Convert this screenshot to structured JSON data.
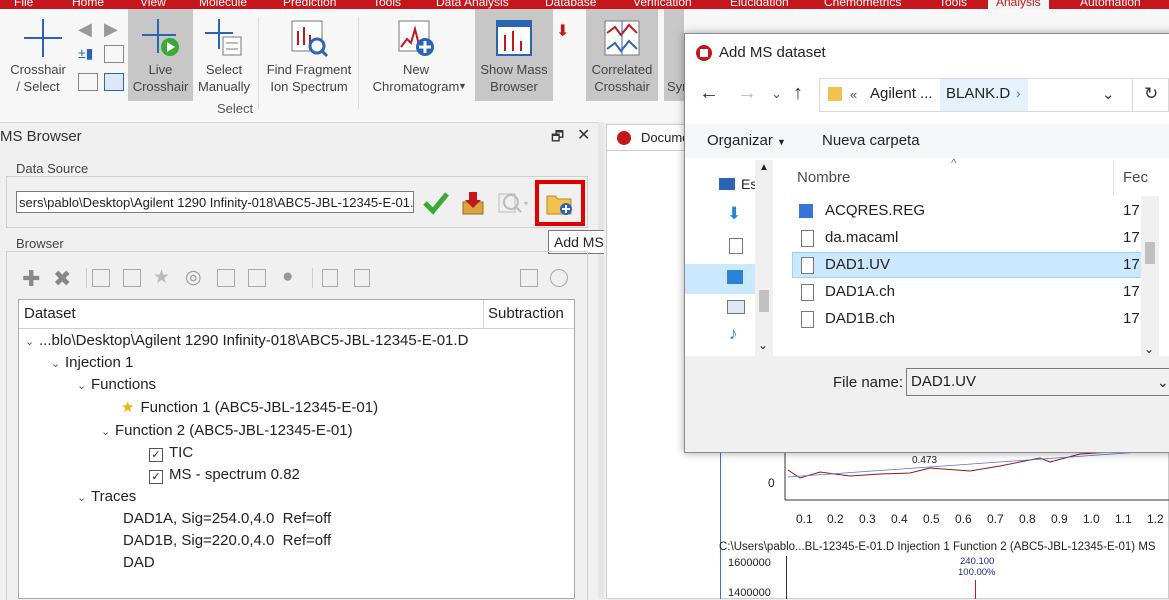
{
  "menubar": {
    "items": [
      "File",
      "Home",
      "View",
      "Molecule",
      "Prediction",
      "Tools",
      "Data Analysis",
      "Database",
      "Verification",
      "Elucidation",
      "Chemometrics",
      "Tools",
      "Analysis",
      "Automation"
    ],
    "active_tab": "Analysis"
  },
  "ribbon": {
    "crosshair_select": "Crosshair\n/ Select",
    "live_crosshair": "Live\nCrosshair",
    "select_manually": "Select\nManually",
    "find_fragment": "Find Fragment\nIon Spectrum",
    "new_chromatogram": "New\nChromatogram",
    "show_mass_browser": "Show Mass\nBrowser",
    "correlated_crosshair": "Correlated\nCrosshair",
    "sym_partial": "Sym",
    "select_group_label": "Select"
  },
  "ms_browser": {
    "title": "MS Browser",
    "data_source_legend": "Data Source",
    "path_value": "sers\\pablo\\Desktop\\Agilent 1290 Infinity-018\\ABC5-JBL-12345-E-01.D",
    "browser_legend": "Browser",
    "tooltip": "Add MS dataset",
    "columns": [
      "Dataset",
      "Subtraction"
    ],
    "tree": [
      {
        "label": "...blo\\Desktop\\Agilent 1290 Infinity-018\\ABC5-JBL-12345-E-01.D"
      },
      {
        "label": "Injection 1"
      },
      {
        "label": "Functions"
      },
      {
        "label": "Function 1 (ABC5-JBL-12345-E-01)"
      },
      {
        "label": "Function 2 (ABC5-JBL-12345-E-01)"
      },
      {
        "label": "TIC"
      },
      {
        "label": "MS - spectrum 0.82"
      },
      {
        "label": "Traces"
      },
      {
        "label": "DAD1A, Sig=254.0,4.0  Ref=off"
      },
      {
        "label": "DAD1B, Sig=220.0,4.0  Ref=off"
      },
      {
        "label": "DAD"
      }
    ]
  },
  "document": {
    "tab_label": "Docume",
    "x_ticks": [
      "0.1",
      "0.2",
      "0.3",
      "0.4",
      "0.5",
      "0.6",
      "0.7",
      "0.8",
      "0.9",
      "1.0",
      "1.1",
      "1.2"
    ],
    "y_zero": "0",
    "peak_label": "0.473",
    "status_path": "C:\\Users\\pablo...BL-12345-E-01.D Injection 1 Function 2 (ABC5-JBL-12345-E-01) MS",
    "spectrum_y1": "1600000",
    "spectrum_y2": "1400000",
    "spectrum_peak_mass": "240.100",
    "spectrum_peak_pct": "100.00%"
  },
  "dialog": {
    "title": "Add MS dataset",
    "breadcrumb_parent": "Agilent ...",
    "breadcrumb_current": "BLANK.D",
    "organize": "Organizar",
    "new_folder": "Nueva carpeta",
    "col_name": "Nombre",
    "col_date": "Fec",
    "nav_label": "Es",
    "files": [
      {
        "name": "ACQRES.REG",
        "date": "17,"
      },
      {
        "name": "da.macaml",
        "date": "17,"
      },
      {
        "name": "DAD1.UV",
        "date": "17,"
      },
      {
        "name": "DAD1A.ch",
        "date": "17,"
      },
      {
        "name": "DAD1B.ch",
        "date": "17,"
      }
    ],
    "file_name_label": "File name:",
    "file_name_value": "DAD1.UV"
  }
}
